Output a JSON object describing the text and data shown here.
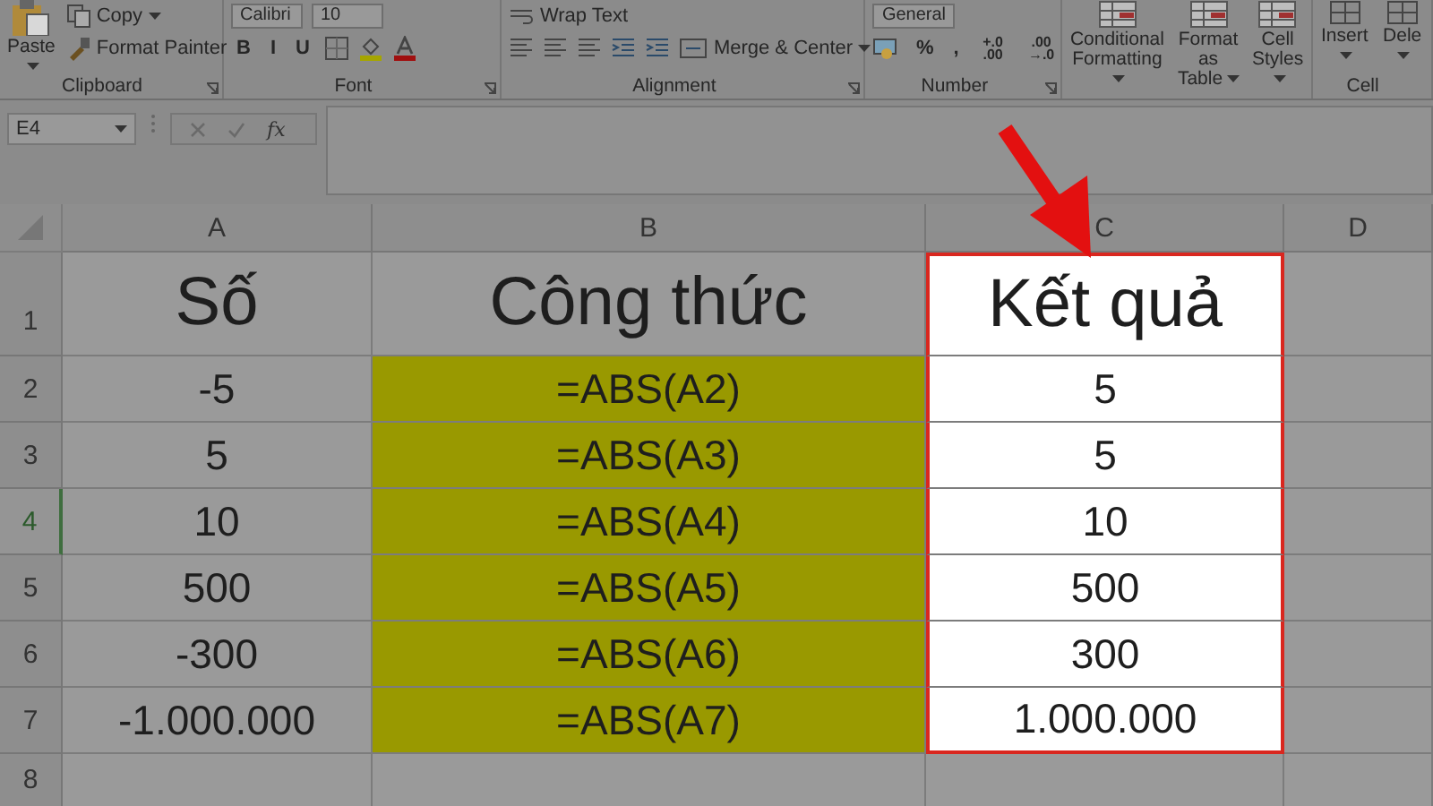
{
  "ribbon": {
    "groups": [
      {
        "label": "Clipboard",
        "launcher": true,
        "large": [
          {
            "kind": "paste",
            "label": "Paste"
          }
        ],
        "upper": [
          {
            "kind": "copy",
            "label": "Copy"
          }
        ],
        "lower": [
          {
            "kind": "format-painter",
            "label": "Format Painter"
          }
        ]
      },
      {
        "label": "Font",
        "launcher": true,
        "upper": [
          {
            "kind": "field",
            "label": "Calibri"
          },
          {
            "kind": "field",
            "label": "10"
          }
        ],
        "lower": [
          {
            "kind": "letter",
            "label": "B"
          },
          {
            "kind": "letter",
            "label": "I"
          },
          {
            "kind": "letter",
            "label": "U"
          },
          {
            "kind": "borders"
          },
          {
            "kind": "fill-color"
          },
          {
            "kind": "font-color"
          }
        ]
      },
      {
        "label": "Alignment",
        "launcher": true,
        "upper": [
          {
            "kind": "wrap-text",
            "label": "Wrap Text"
          }
        ],
        "lower": [
          {
            "kind": "align"
          },
          {
            "kind": "align"
          },
          {
            "kind": "align"
          },
          {
            "kind": "indent"
          },
          {
            "kind": "indent"
          },
          {
            "kind": "merge",
            "label": "Merge & Center"
          }
        ]
      },
      {
        "label": "Number",
        "launcher": true,
        "upper": [
          {
            "kind": "field",
            "label": "General"
          }
        ],
        "lower": [
          {
            "kind": "accounting"
          },
          {
            "kind": "letter",
            "label": "%"
          },
          {
            "kind": "letter",
            "label": ","
          },
          {
            "kind": "decimal",
            "label": "+.0 .00"
          },
          {
            "kind": "decimal",
            "label": ".00 →.0"
          }
        ]
      },
      {
        "launcher": false,
        "large": [
          {
            "kind": "styles",
            "label": "Conditional Formatting"
          },
          {
            "kind": "styles",
            "label": "Format as Table"
          },
          {
            "kind": "styles",
            "label": "Cell Styles"
          }
        ]
      },
      {
        "label": "Cell",
        "launcher": false,
        "large": [
          {
            "kind": "cells",
            "label": "Insert"
          },
          {
            "kind": "cells",
            "label": "Dele"
          }
        ]
      }
    ]
  },
  "formula_bar": {
    "name_box": "E4",
    "function_label": "fx"
  },
  "sheet": {
    "columns": [
      {
        "label": "A"
      },
      {
        "label": "B"
      },
      {
        "label": "C"
      },
      {
        "label": "D"
      }
    ],
    "rows": [
      {
        "header": "1",
        "selected": false,
        "kind": "title",
        "cells": [
          {
            "text": "Số"
          },
          {
            "text": "Công thức"
          },
          {
            "text": "Kết quả",
            "highlighted": true
          }
        ]
      },
      {
        "header": "2",
        "selected": false,
        "kind": "data",
        "cells": [
          {
            "text": "-5"
          },
          {
            "text": "=ABS(A2)",
            "color": "#999900"
          },
          {
            "text": "5",
            "highlighted": true
          }
        ]
      },
      {
        "header": "3",
        "selected": false,
        "kind": "data",
        "cells": [
          {
            "text": "5"
          },
          {
            "text": "=ABS(A3)",
            "color": "#999900"
          },
          {
            "text": "5",
            "highlighted": true
          }
        ]
      },
      {
        "header": "4",
        "selected": true,
        "kind": "data",
        "cells": [
          {
            "text": "10"
          },
          {
            "text": "=ABS(A4)",
            "color": "#999900"
          },
          {
            "text": "10",
            "highlighted": true
          }
        ]
      },
      {
        "header": "5",
        "selected": false,
        "kind": "data",
        "cells": [
          {
            "text": "500"
          },
          {
            "text": "=ABS(A5)",
            "color": "#999900"
          },
          {
            "text": "500",
            "highlighted": true
          }
        ]
      },
      {
        "header": "6",
        "selected": false,
        "kind": "data",
        "cells": [
          {
            "text": "-300"
          },
          {
            "text": "=ABS(A6)",
            "color": "#999900"
          },
          {
            "text": "300",
            "highlighted": true
          }
        ]
      },
      {
        "header": "7",
        "selected": false,
        "kind": "data",
        "cells": [
          {
            "text": "-1.000.000"
          },
          {
            "text": "=ABS(A7)",
            "color": "#999900"
          },
          {
            "text": "1.000.000",
            "highlighted": true
          }
        ]
      },
      {
        "header": "8",
        "selected": false,
        "kind": "data"
      }
    ]
  }
}
